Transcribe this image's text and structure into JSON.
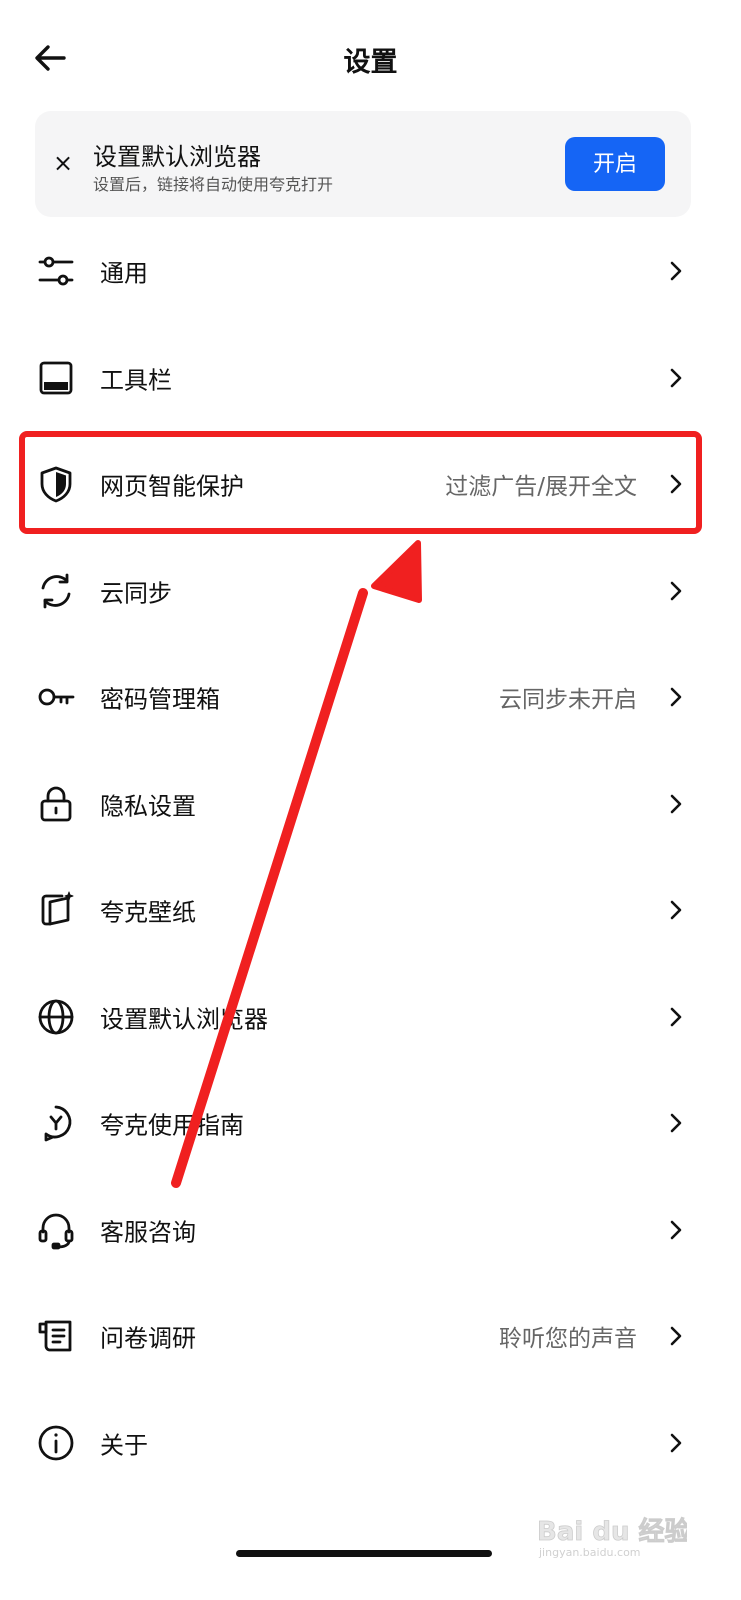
{
  "header": {
    "title": "设置",
    "back_icon": "arrow-left-icon"
  },
  "banner": {
    "close_icon": "close-icon",
    "close_glyph": "×",
    "title": "设置默认浏览器",
    "subtitle": "设置后，链接将自动使用夸克打开",
    "button_label": "开启",
    "button_color": "#1565f5"
  },
  "settings": [
    {
      "id": "general",
      "label": "通用",
      "value": "",
      "icon": "sliders-icon"
    },
    {
      "id": "toolbar",
      "label": "工具栏",
      "value": "",
      "icon": "toolbar-icon"
    },
    {
      "id": "web-protection",
      "label": "网页智能保护",
      "value": "过滤广告/展开全文",
      "icon": "shield-icon"
    },
    {
      "id": "cloud-sync",
      "label": "云同步",
      "value": "",
      "icon": "sync-icon"
    },
    {
      "id": "password-manager",
      "label": "密码管理箱",
      "value": "云同步未开启",
      "icon": "key-icon"
    },
    {
      "id": "privacy",
      "label": "隐私设置",
      "value": "",
      "icon": "lock-icon"
    },
    {
      "id": "wallpaper",
      "label": "夸克壁纸",
      "value": "",
      "icon": "wallpaper-icon"
    },
    {
      "id": "default-browser",
      "label": "设置默认浏览器",
      "value": "",
      "icon": "globe-icon"
    },
    {
      "id": "guide",
      "label": "夸克使用指南",
      "value": "",
      "icon": "guide-icon"
    },
    {
      "id": "support",
      "label": "客服咨询",
      "value": "",
      "icon": "headset-icon"
    },
    {
      "id": "survey",
      "label": "问卷调研",
      "value": "聆听您的声音",
      "icon": "survey-icon"
    },
    {
      "id": "about",
      "label": "关于",
      "value": "",
      "icon": "info-icon"
    }
  ],
  "annotation": {
    "highlight_color": "#f02020",
    "highlighted_item": "网页智能保护"
  },
  "watermark": {
    "text": "Bai du 经验",
    "subtext": "jingyan.baidu.com"
  }
}
